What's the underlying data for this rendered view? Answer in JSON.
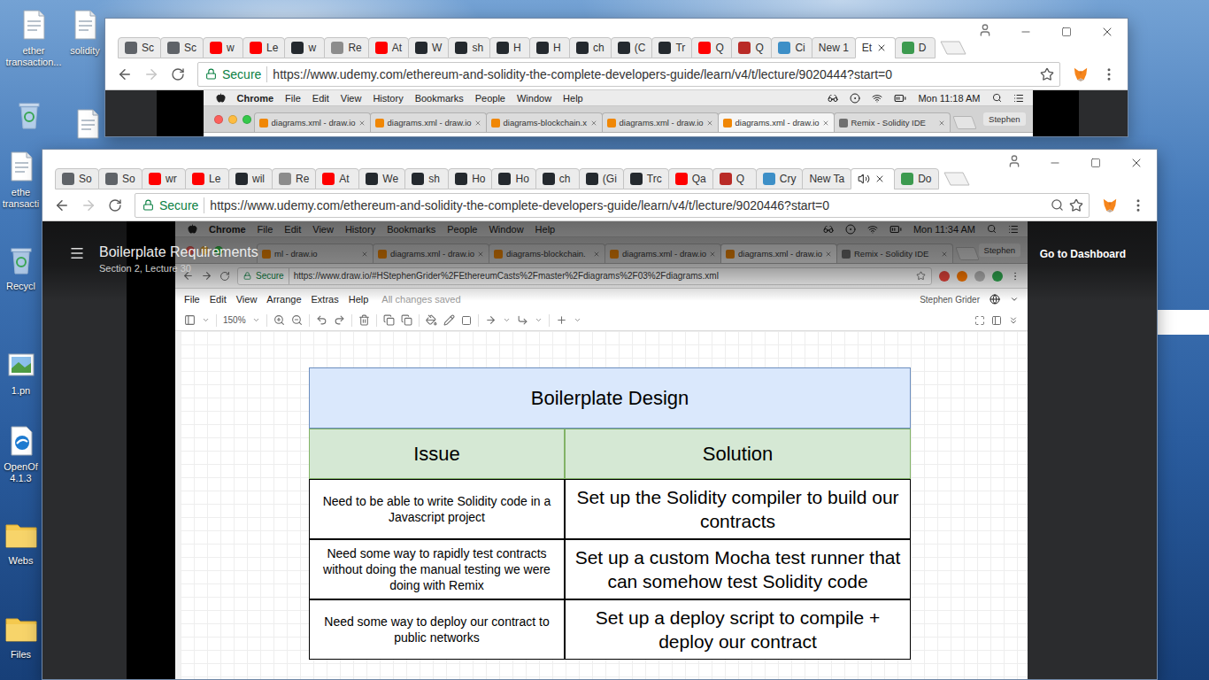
{
  "desktop": {
    "icons": [
      {
        "label": "ether transaction...",
        "selected": false
      },
      {
        "label": "solidity",
        "selected": false
      },
      {
        "selected": false
      },
      {
        "selected": false
      },
      {
        "label": "ethe transacti",
        "selected": false
      },
      {
        "label": "Recycl",
        "selected": false
      },
      {
        "label": "1.pn",
        "selected": false
      },
      {
        "label": "OpenOf 4.1.3",
        "selected": false
      },
      {
        "label": "Webs",
        "selected": false
      },
      {
        "label": "Files",
        "selected": false
      }
    ]
  },
  "back_window": {
    "tabs": [
      {
        "label": "Sc",
        "color": "#5f6368",
        "selected": false,
        "audio": false
      },
      {
        "label": "Sc",
        "color": "#5f6368",
        "selected": false,
        "audio": false
      },
      {
        "label": "w",
        "color": "#ff0000",
        "selected": false,
        "audio": false
      },
      {
        "label": "Le",
        "color": "#ff0000",
        "selected": false,
        "audio": false
      },
      {
        "label": "w",
        "color": "#24292e",
        "selected": false,
        "audio": false
      },
      {
        "label": "Re",
        "color": "#8c8c8c",
        "selected": false,
        "audio": false
      },
      {
        "label": "At",
        "color": "#ff0000",
        "selected": false,
        "audio": false
      },
      {
        "label": "W",
        "color": "#24292e",
        "selected": false,
        "audio": false
      },
      {
        "label": "sh",
        "color": "#24292e",
        "selected": false,
        "audio": false
      },
      {
        "label": "H",
        "color": "#24292e",
        "selected": false,
        "audio": false
      },
      {
        "label": "H",
        "color": "#24292e",
        "selected": false,
        "audio": false
      },
      {
        "label": "ch",
        "color": "#24292e",
        "selected": false,
        "audio": false
      },
      {
        "label": "(C",
        "color": "#24292e",
        "selected": false,
        "audio": false
      },
      {
        "label": "Tr",
        "color": "#24292e",
        "selected": false,
        "audio": false
      },
      {
        "label": "Q",
        "color": "#ff0000",
        "selected": false,
        "audio": false
      },
      {
        "label": "Q",
        "color": "#b92b27",
        "selected": false,
        "audio": false
      },
      {
        "label": "Ci",
        "color": "#3d8fc7",
        "selected": false,
        "audio": false
      },
      {
        "label": "New 1",
        "selected": false,
        "audio": false
      },
      {
        "label": "Et",
        "selected": true,
        "audio": false
      },
      {
        "label": "D",
        "color": "#3c9a4f",
        "selected": false,
        "audio": false
      }
    ],
    "navigation": {
      "can_go_back": true,
      "can_go_forward": false
    },
    "omnibox": {
      "security": "Secure",
      "url": "https://www.udemy.com/ethereum-and-solidity-the-complete-developers-guide/learn/v4/t/lecture/9020444?start=0",
      "zoomed": false
    },
    "video": {
      "mac": {
        "menubar": {
          "app": "Chrome",
          "menus": [
            "File",
            "Edit",
            "View",
            "History",
            "Bookmarks",
            "People",
            "Window",
            "Help"
          ],
          "clock": "Mon 11:18 AM"
        },
        "tabs": [
          {
            "label": "diagrams.xml - draw.io",
            "color": "#f08705",
            "selected": false
          },
          {
            "label": "diagrams.xml - draw.io",
            "color": "#f08705",
            "selected": false
          },
          {
            "label": "diagrams-blockchain.x",
            "color": "#f08705",
            "selected": false
          },
          {
            "label": "diagrams.xml - draw.io",
            "color": "#f08705",
            "selected": false
          },
          {
            "label": "diagrams.xml - draw.io",
            "color": "#f08705",
            "selected": true
          },
          {
            "label": "Remix - Solidity IDE",
            "color": "#6f6f6f",
            "selected": false
          }
        ],
        "user": "Stephen"
      }
    }
  },
  "front_window": {
    "tabs": [
      {
        "label": "So",
        "color": "#5f6368",
        "selected": false,
        "audio": false
      },
      {
        "label": "So",
        "color": "#5f6368",
        "selected": false,
        "audio": false
      },
      {
        "label": "wr",
        "color": "#ff0000",
        "selected": false,
        "audio": false
      },
      {
        "label": "Le",
        "color": "#ff0000",
        "selected": false,
        "audio": false
      },
      {
        "label": "wil",
        "color": "#24292e",
        "selected": false,
        "audio": false
      },
      {
        "label": "Re",
        "color": "#8c8c8c",
        "selected": false,
        "audio": false
      },
      {
        "label": "At",
        "color": "#ff0000",
        "selected": false,
        "audio": false
      },
      {
        "label": "We",
        "color": "#24292e",
        "selected": false,
        "audio": false
      },
      {
        "label": "sh",
        "color": "#24292e",
        "selected": false,
        "audio": false
      },
      {
        "label": "Ho",
        "color": "#24292e",
        "selected": false,
        "audio": false
      },
      {
        "label": "Ho",
        "color": "#24292e",
        "selected": false,
        "audio": false
      },
      {
        "label": "ch",
        "color": "#24292e",
        "selected": false,
        "audio": false
      },
      {
        "label": "(Gi",
        "color": "#24292e",
        "selected": false,
        "audio": false
      },
      {
        "label": "Trc",
        "color": "#24292e",
        "selected": false,
        "audio": false
      },
      {
        "label": "Qa",
        "color": "#ff0000",
        "selected": false,
        "audio": false
      },
      {
        "label": "Q",
        "color": "#b92b27",
        "selected": false,
        "audio": false
      },
      {
        "label": "Cry",
        "color": "#3d8fc7",
        "selected": false,
        "audio": false
      },
      {
        "label": "New Ta",
        "selected": false,
        "audio": false
      },
      {
        "selected": true,
        "audio": true
      },
      {
        "label": "Do",
        "color": "#3c9a4f",
        "selected": false,
        "audio": false
      }
    ],
    "navigation": {
      "can_go_back": true,
      "can_go_forward": false
    },
    "omnibox": {
      "security": "Secure",
      "url": "https://www.udemy.com/ethereum-and-solidity-the-complete-developers-guide/learn/v4/t/lecture/9020446?start=0",
      "zoomed": true
    },
    "player": {
      "title": "Boilerplate Requirements",
      "subtitle": "Section 2, Lecture 30",
      "dashboard": "Go to Dashboard"
    },
    "video": {
      "mac": {
        "menubar": {
          "app": "Chrome",
          "menus": [
            "File",
            "Edit",
            "View",
            "History",
            "Bookmarks",
            "People",
            "Window",
            "Help"
          ],
          "clock": "Mon 11:34 AM"
        },
        "tabs": [
          {
            "label": "ml - draw.io",
            "color": "#f08705",
            "selected": false
          },
          {
            "label": "diagrams.xml - draw.io",
            "color": "#f08705",
            "selected": false
          },
          {
            "label": "diagrams-blockchain.",
            "color": "#f08705",
            "selected": false
          },
          {
            "label": "diagrams.xml - draw.io",
            "color": "#f08705",
            "selected": false
          },
          {
            "label": "diagrams.xml - draw.io",
            "color": "#f08705",
            "selected": true
          },
          {
            "label": "Remix - Solidity IDE",
            "color": "#6f6f6f",
            "selected": false
          }
        ],
        "user": "Stephen",
        "omnibox": {
          "security": "Secure",
          "url": "https://www.draw.io/#HStephenGrider%2FEthereumCasts%2Fmaster%2Fdiagrams%2F03%2Fdiagrams.xml"
        }
      },
      "drawio": {
        "menus": [
          "File",
          "Edit",
          "View",
          "Arrange",
          "Extras",
          "Help"
        ],
        "status": "All changes saved",
        "user": "Stephen Grider",
        "zoom": "150%",
        "table": {
          "title": "Boilerplate Design",
          "columns": [
            "Issue",
            "Solution"
          ],
          "rows": [
            {
              "issue": "Need to be able to write Solidity code in a Javascript project",
              "solution": "Set up the Solidity compiler to build our contracts"
            },
            {
              "issue": "Need some way to rapidly test contracts without doing the manual testing we were doing with Remix",
              "solution": "Set up a custom Mocha test runner that can somehow test Solidity code"
            },
            {
              "issue": "Need some way to deploy our contract to public networks",
              "solution": "Set up a deploy script to compile + deploy our contract"
            }
          ]
        }
      }
    }
  }
}
